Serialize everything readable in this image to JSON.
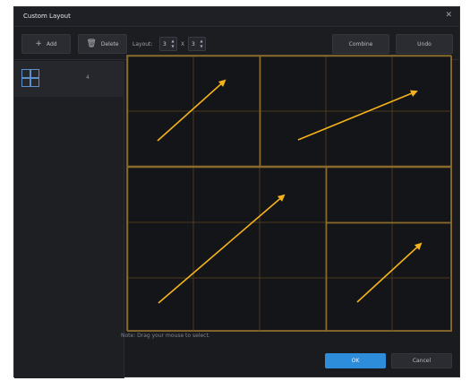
{
  "window": {
    "title": "Custom Layout"
  },
  "toolbar": {
    "add_label": "Add",
    "delete_label": "Delete",
    "layout_label": "Layout:",
    "rows_value": "3",
    "x_label": "X",
    "cols_value": "3",
    "combine_label": "Combine",
    "undo_label": "Undo"
  },
  "sidebar": {
    "items": [
      {
        "label": "4"
      }
    ]
  },
  "hint": "Note: Drag your mouse to select.",
  "footer": {
    "ok_label": "OK",
    "cancel_label": "Cancel"
  },
  "colors": {
    "accent": "#2e8ddb",
    "cell_border": "#8a6a2a",
    "arrow": "#f5b21a"
  }
}
